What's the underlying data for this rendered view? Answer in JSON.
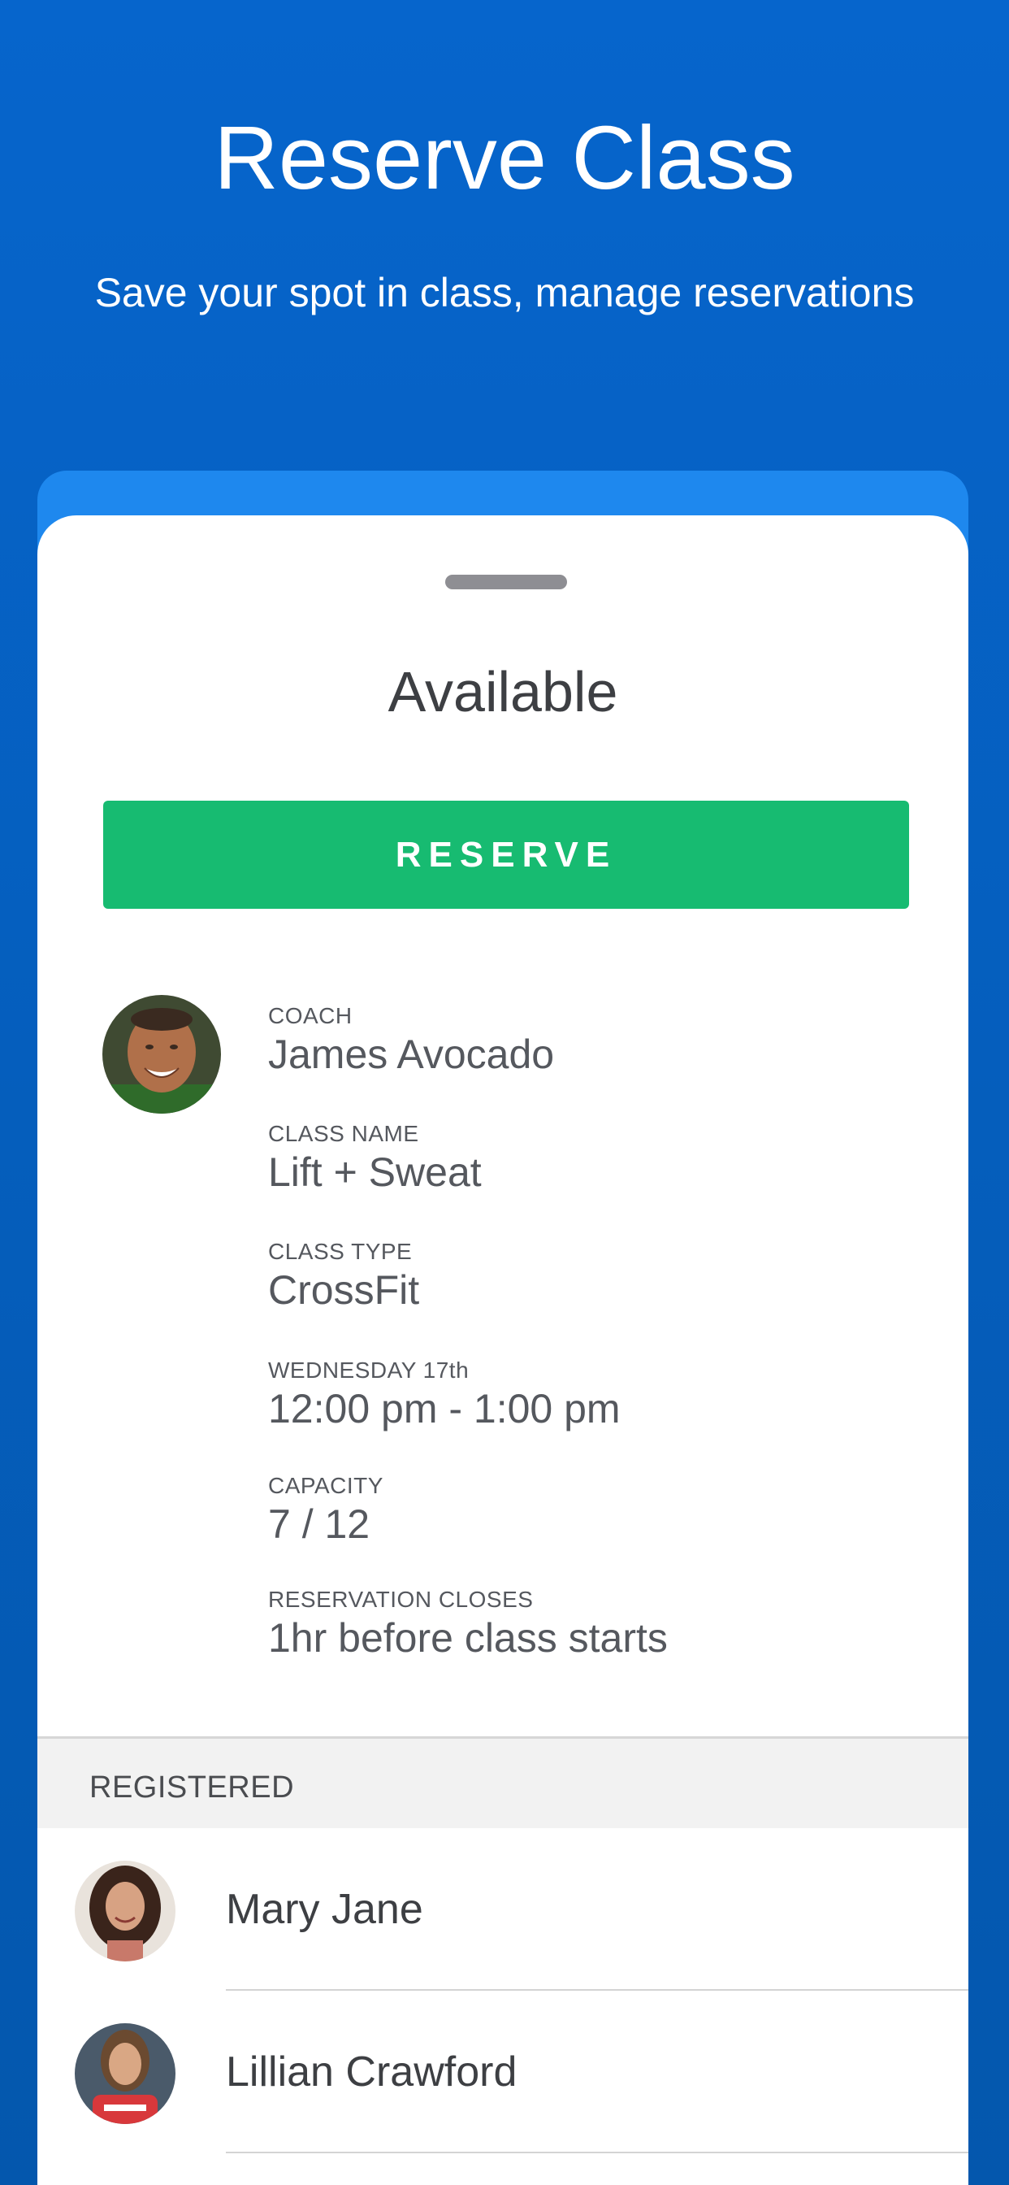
{
  "hero": {
    "title": "Reserve Class",
    "subtitle": "Save your spot in class, manage reservations"
  },
  "card": {
    "status": "Available",
    "reserve_label": "RESERVE",
    "details": [
      {
        "label": "COACH",
        "value": "James Avocado"
      },
      {
        "label": "CLASS NAME",
        "value": "Lift + Sweat"
      },
      {
        "label": "CLASS TYPE",
        "value": "CrossFit"
      },
      {
        "label": "WEDNESDAY 17th",
        "value": "12:00 pm - 1:00 pm"
      },
      {
        "label": "CAPACITY",
        "value": "7 / 12"
      },
      {
        "label": "RESERVATION CLOSES",
        "value": "1hr before class starts"
      }
    ]
  },
  "registered": {
    "header": "REGISTERED",
    "members": [
      {
        "name": "Mary Jane"
      },
      {
        "name": "Lillian Crawford"
      }
    ]
  },
  "colors": {
    "background": "#0665cc",
    "card_accent": "#1e88ee",
    "reserve_button": "#17bb71"
  },
  "icons": {
    "coach_avatar": "person-avatar",
    "member_avatar": "person-avatar"
  }
}
